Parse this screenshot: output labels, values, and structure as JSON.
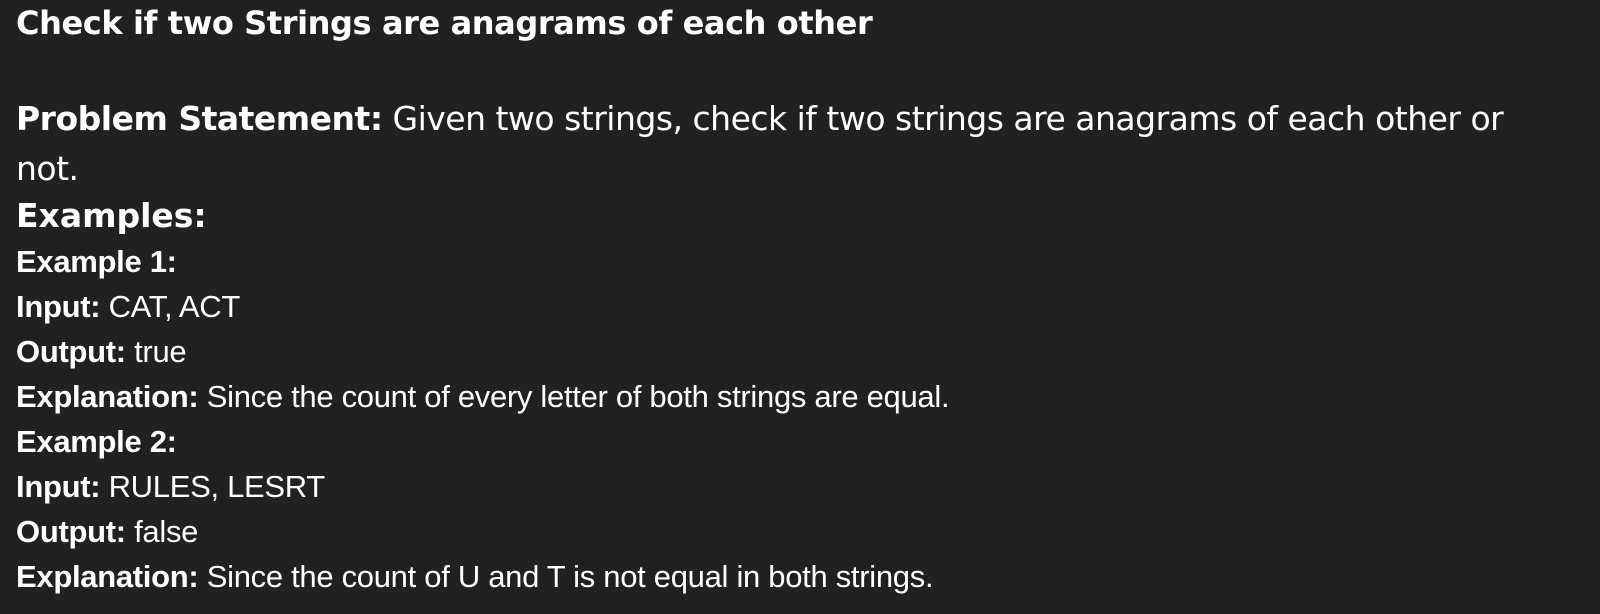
{
  "title": "Check if two Strings are anagrams of each other",
  "problem": {
    "label": "Problem Statement:",
    "text_line1": " Given two strings, check if two strings are anagrams of each other or",
    "text_line2": "not."
  },
  "examples_heading": "Examples:",
  "examples": [
    {
      "heading": "Example 1:",
      "input_label": "Input:",
      "input_value": " CAT, ACT",
      "output_label": "Output:",
      "output_value": " true",
      "explanation_label": "Explanation:",
      "explanation_value": " Since the count of every letter of both strings are equal."
    },
    {
      "heading": "Example 2:",
      "input_label": "Input:",
      "input_value": " RULES, LESRT",
      "output_label": "Output:",
      "output_value": " false",
      "explanation_label": "Explanation:",
      "explanation_value": " Since the count of U and T  is not equal in both strings."
    }
  ]
}
